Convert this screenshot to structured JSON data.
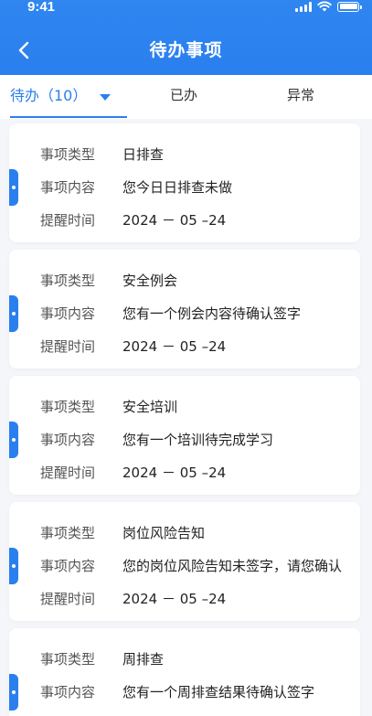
{
  "status_bar": {
    "time": "9:41"
  },
  "header": {
    "title": "待办事项"
  },
  "tabs": [
    {
      "label": "待办（10）"
    },
    {
      "label": "已办"
    },
    {
      "label": "异常"
    }
  ],
  "labels": {
    "type": "事项类型",
    "content": "事项内容",
    "time": "提醒时间"
  },
  "items": [
    {
      "type": "日排查",
      "content": "您今日日排查未做",
      "time": "2024 － 05 –24"
    },
    {
      "type": "安全例会",
      "content": "您有一个例会内容待确认签字",
      "time": "2024 － 05 –24"
    },
    {
      "type": "安全培训",
      "content": "您有一个培训待完成学习",
      "time": "2024 － 05 –24"
    },
    {
      "type": "岗位风险告知",
      "content": "您的岗位风险告知未签字，请您确认",
      "time": "2024 － 05 –24"
    },
    {
      "type": "周排查",
      "content": "您有一个周排查结果待确认签字",
      "time": ""
    }
  ],
  "colors": {
    "primary": "#2a7fee",
    "background": "#f4f6fa"
  }
}
